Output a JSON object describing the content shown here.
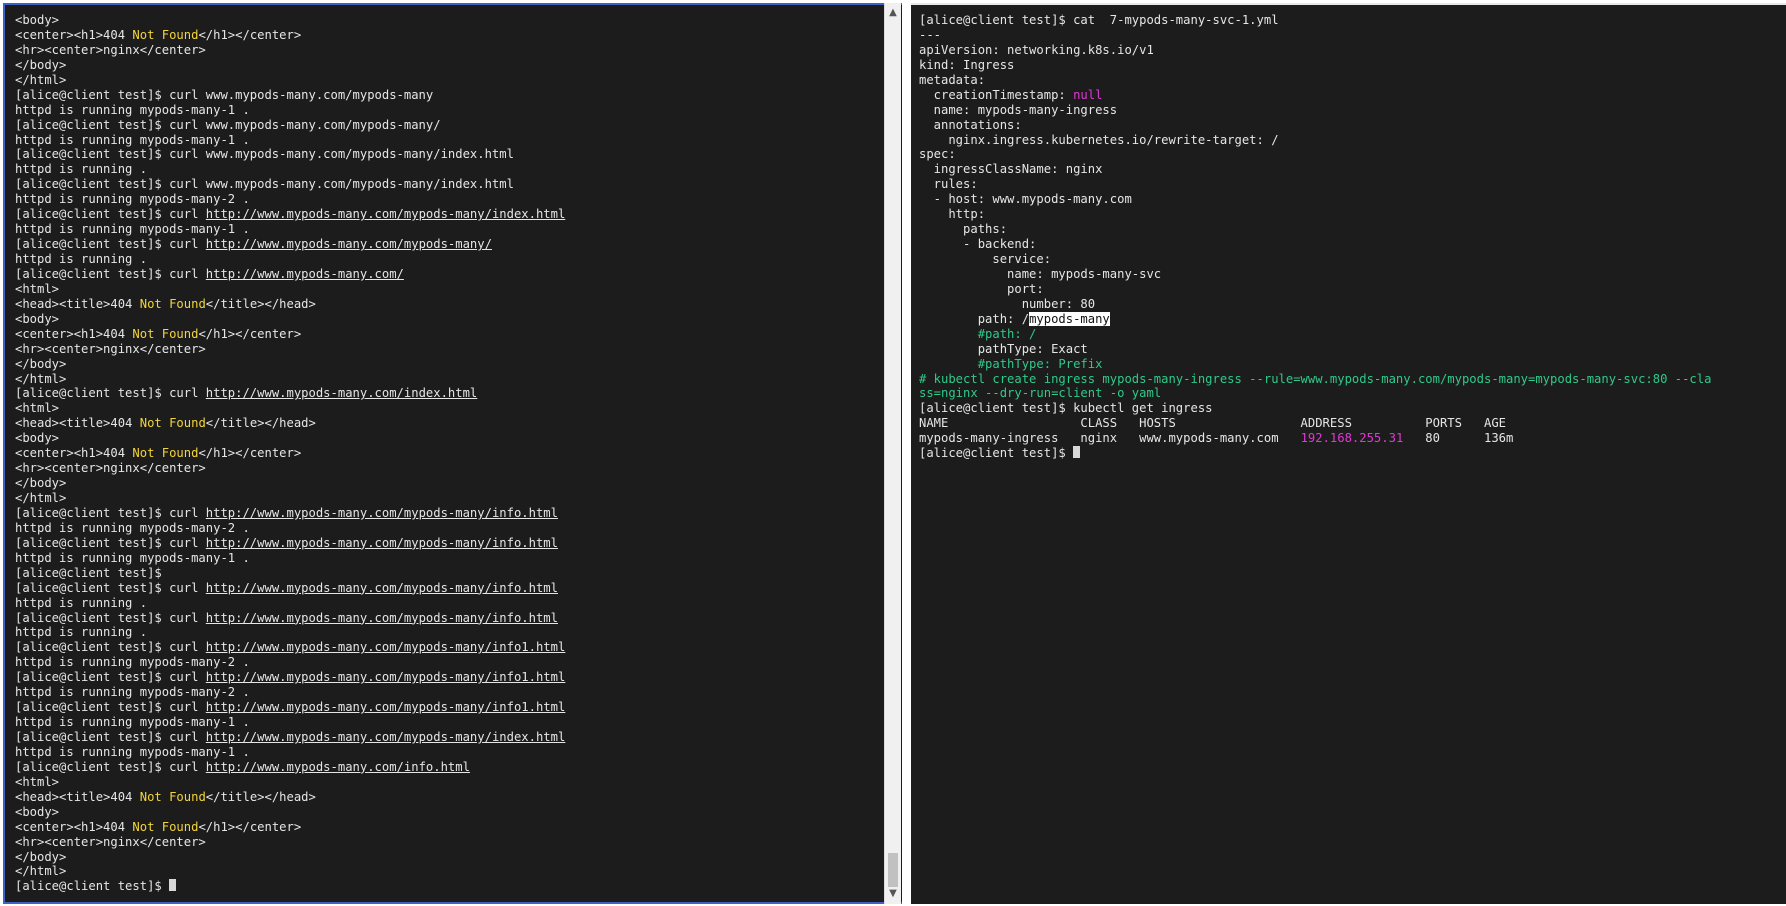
{
  "left_terminal": {
    "lines": [
      [
        {
          "t": "<body>"
        }
      ],
      [
        {
          "t": "<center><h1>404 "
        },
        {
          "t": "Not Found",
          "c": "yellow"
        },
        {
          "t": "</h1></center>"
        }
      ],
      [
        {
          "t": "<hr><center>nginx</center>"
        }
      ],
      [
        {
          "t": "</body>"
        }
      ],
      [
        {
          "t": "</html>"
        }
      ],
      [
        {
          "t": "[alice@client test]$ curl www.mypods-many.com/mypods-many"
        }
      ],
      [
        {
          "t": "httpd is running mypods-many-1 ."
        }
      ],
      [
        {
          "t": "[alice@client test]$ curl www.mypods-many.com/mypods-many/"
        }
      ],
      [
        {
          "t": "httpd is running mypods-many-1 ."
        }
      ],
      [
        {
          "t": "[alice@client test]$ curl www.mypods-many.com/mypods-many/index.html"
        }
      ],
      [
        {
          "t": "httpd is running ."
        }
      ],
      [
        {
          "t": "[alice@client test]$ curl www.mypods-many.com/mypods-many/index.html"
        }
      ],
      [
        {
          "t": "httpd is running mypods-many-2 ."
        }
      ],
      [
        {
          "t": "[alice@client test]$ curl "
        },
        {
          "t": "http://www.mypods-many.com/mypods-many/index.html",
          "c": "link"
        }
      ],
      [
        {
          "t": "httpd is running mypods-many-1 ."
        }
      ],
      [
        {
          "t": "[alice@client test]$ curl "
        },
        {
          "t": "http://www.mypods-many.com/mypods-many/",
          "c": "link"
        }
      ],
      [
        {
          "t": "httpd is running ."
        }
      ],
      [
        {
          "t": "[alice@client test]$ curl "
        },
        {
          "t": "http://www.mypods-many.com/",
          "c": "link"
        }
      ],
      [
        {
          "t": "<html>"
        }
      ],
      [
        {
          "t": "<head><title>404 "
        },
        {
          "t": "Not Found",
          "c": "yellow"
        },
        {
          "t": "</title></head>"
        }
      ],
      [
        {
          "t": "<body>"
        }
      ],
      [
        {
          "t": "<center><h1>404 "
        },
        {
          "t": "Not Found",
          "c": "yellow"
        },
        {
          "t": "</h1></center>"
        }
      ],
      [
        {
          "t": "<hr><center>nginx</center>"
        }
      ],
      [
        {
          "t": "</body>"
        }
      ],
      [
        {
          "t": "</html>"
        }
      ],
      [
        {
          "t": "[alice@client test]$ curl "
        },
        {
          "t": "http://www.mypods-many.com/index.html",
          "c": "link"
        }
      ],
      [
        {
          "t": "<html>"
        }
      ],
      [
        {
          "t": "<head><title>404 "
        },
        {
          "t": "Not Found",
          "c": "yellow"
        },
        {
          "t": "</title></head>"
        }
      ],
      [
        {
          "t": "<body>"
        }
      ],
      [
        {
          "t": "<center><h1>404 "
        },
        {
          "t": "Not Found",
          "c": "yellow"
        },
        {
          "t": "</h1></center>"
        }
      ],
      [
        {
          "t": "<hr><center>nginx</center>"
        }
      ],
      [
        {
          "t": "</body>"
        }
      ],
      [
        {
          "t": "</html>"
        }
      ],
      [
        {
          "t": "[alice@client test]$ curl "
        },
        {
          "t": "http://www.mypods-many.com/mypods-many/info.html",
          "c": "link"
        }
      ],
      [
        {
          "t": "httpd is running mypods-many-2 ."
        }
      ],
      [
        {
          "t": "[alice@client test]$ curl "
        },
        {
          "t": "http://www.mypods-many.com/mypods-many/info.html",
          "c": "link"
        }
      ],
      [
        {
          "t": "httpd is running mypods-many-1 ."
        }
      ],
      [
        {
          "t": "[alice@client test]$"
        }
      ],
      [
        {
          "t": "[alice@client test]$ curl "
        },
        {
          "t": "http://www.mypods-many.com/mypods-many/info.html",
          "c": "link"
        }
      ],
      [
        {
          "t": "httpd is running ."
        }
      ],
      [
        {
          "t": "[alice@client test]$ curl "
        },
        {
          "t": "http://www.mypods-many.com/mypods-many/info.html",
          "c": "link"
        }
      ],
      [
        {
          "t": "httpd is running ."
        }
      ],
      [
        {
          "t": "[alice@client test]$ curl "
        },
        {
          "t": "http://www.mypods-many.com/mypods-many/info1.html",
          "c": "link"
        }
      ],
      [
        {
          "t": "httpd is running mypods-many-2 ."
        }
      ],
      [
        {
          "t": "[alice@client test]$ curl "
        },
        {
          "t": "http://www.mypods-many.com/mypods-many/info1.html",
          "c": "link"
        }
      ],
      [
        {
          "t": "httpd is running mypods-many-2 ."
        }
      ],
      [
        {
          "t": "[alice@client test]$ curl "
        },
        {
          "t": "http://www.mypods-many.com/mypods-many/info1.html",
          "c": "link"
        }
      ],
      [
        {
          "t": "httpd is running mypods-many-1 ."
        }
      ],
      [
        {
          "t": "[alice@client test]$ curl "
        },
        {
          "t": "http://www.mypods-many.com/mypods-many/index.html",
          "c": "link"
        }
      ],
      [
        {
          "t": "httpd is running mypods-many-1 ."
        }
      ],
      [
        {
          "t": "[alice@client test]$ curl "
        },
        {
          "t": "http://www.mypods-many.com/info.html",
          "c": "link"
        }
      ],
      [
        {
          "t": "<html>"
        }
      ],
      [
        {
          "t": "<head><title>404 "
        },
        {
          "t": "Not Found",
          "c": "yellow"
        },
        {
          "t": "</title></head>"
        }
      ],
      [
        {
          "t": "<body>"
        }
      ],
      [
        {
          "t": "<center><h1>404 "
        },
        {
          "t": "Not Found",
          "c": "yellow"
        },
        {
          "t": "</h1></center>"
        }
      ],
      [
        {
          "t": "<hr><center>nginx</center>"
        }
      ],
      [
        {
          "t": "</body>"
        }
      ],
      [
        {
          "t": "</html>"
        }
      ],
      [
        {
          "t": "[alice@client test]$ "
        },
        {
          "cursor": true
        }
      ]
    ]
  },
  "right_terminal": {
    "lines": [
      [
        {
          "t": "[alice@client test]$ cat  7-mypods-many-svc-1.yml"
        }
      ],
      [
        {
          "t": "---"
        }
      ],
      [
        {
          "t": "apiVersion: networking.k8s.io/v1"
        }
      ],
      [
        {
          "t": "kind: Ingress"
        }
      ],
      [
        {
          "t": "metadata:"
        }
      ],
      [
        {
          "t": "  creationTimestamp: "
        },
        {
          "t": "null",
          "c": "magenta"
        }
      ],
      [
        {
          "t": "  name: mypods-many-ingress"
        }
      ],
      [
        {
          "t": "  annotations:"
        }
      ],
      [
        {
          "t": "    nginx.ingress.kubernetes.io/rewrite-target: /"
        }
      ],
      [
        {
          "t": "spec:"
        }
      ],
      [
        {
          "t": "  ingressClassName: nginx"
        }
      ],
      [
        {
          "t": "  rules:"
        }
      ],
      [
        {
          "t": "  - host: www.mypods-many.com"
        }
      ],
      [
        {
          "t": "    http:"
        }
      ],
      [
        {
          "t": "      paths:"
        }
      ],
      [
        {
          "t": "      - backend:"
        }
      ],
      [
        {
          "t": "          service:"
        }
      ],
      [
        {
          "t": "            name: mypods-many-svc"
        }
      ],
      [
        {
          "t": "            port:"
        }
      ],
      [
        {
          "t": "              number: 80"
        }
      ],
      [
        {
          "t": "        path: /"
        },
        {
          "t": "mypods-many",
          "c": "selected"
        }
      ],
      [
        {
          "t": "        #path: /",
          "c": "green"
        }
      ],
      [
        {
          "t": "        pathType: Exact"
        }
      ],
      [
        {
          "t": "        #pathType: Prefix",
          "c": "green"
        }
      ],
      [
        {
          "t": "# kubectl create ingress mypods-many-ingress --rule=www.mypods-many.com/mypods-many=mypods-many-svc:80 --cla",
          "c": "green"
        }
      ],
      [
        {
          "t": "ss=nginx --dry-run=client -o yaml",
          "c": "green"
        }
      ],
      [
        {
          "t": "[alice@client test]$ kubectl get ingress"
        }
      ],
      [
        {
          "t": "NAME                  CLASS   HOSTS                 ADDRESS          PORTS   AGE"
        }
      ],
      [
        {
          "t": "mypods-many-ingress   nginx   www.mypods-many.com   "
        },
        {
          "t": "192.168.255.31",
          "c": "magenta"
        },
        {
          "t": "   80      136m"
        }
      ],
      [
        {
          "t": "[alice@client test]$ "
        },
        {
          "cursor": true
        }
      ]
    ]
  },
  "scrollbar": {
    "up_glyph": "▲",
    "down_glyph": "▼"
  }
}
